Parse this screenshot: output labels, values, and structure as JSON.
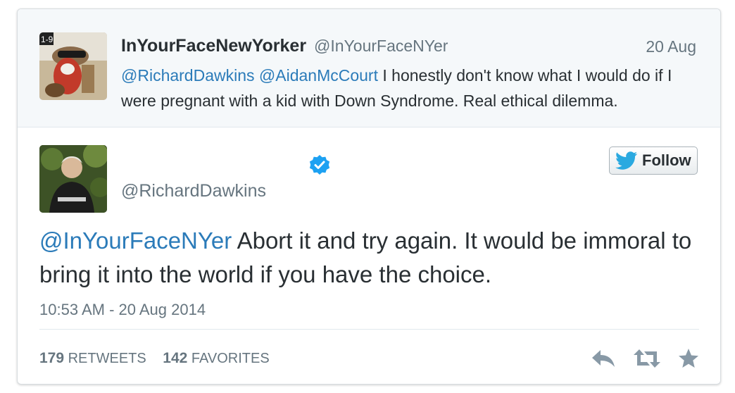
{
  "parent_tweet": {
    "name": "InYourFaceNewYorker",
    "handle": "@InYourFaceNYer",
    "date": "20 Aug",
    "mention_1": "@RichardDawkins",
    "mention_2": "@AidanMcCourt",
    "text": "I honestly don't know what I would do if I were pregnant with a kid with Down Syndrome. Real ethical dilemma."
  },
  "main_tweet": {
    "handle": "@RichardDawkins",
    "follow_label": "Follow",
    "mention": "@InYourFaceNYer",
    "text": "Abort it and try again. It would be immoral to bring it into the world if you have the choice.",
    "timestamp": "10:53 AM - 20 Aug 2014",
    "retweets_count": "179",
    "retweets_label": "RETWEETS",
    "favorites_count": "142",
    "favorites_label": "FAVORITES"
  },
  "icons": {
    "verified": "verified-badge-icon",
    "follow": "twitter-bird-icon",
    "reply": "reply-icon",
    "retweet": "retweet-icon",
    "favorite": "star-icon"
  },
  "colors": {
    "link": "#2b7bb9",
    "verified": "#1da1f2",
    "muted": "#66757f",
    "text": "#292f33",
    "parent_bg": "#f5f8fa",
    "action_icon": "#8899a6"
  }
}
